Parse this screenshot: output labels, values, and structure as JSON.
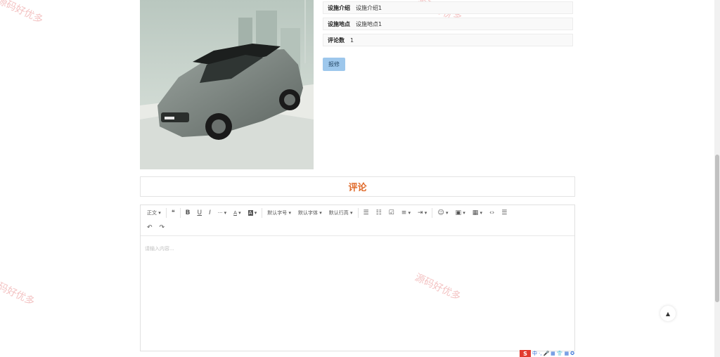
{
  "watermark_text": "源码好优多",
  "facility": {
    "rows": [
      {
        "label": "设施介绍",
        "value": "设施介绍1"
      },
      {
        "label": "设施地点",
        "value": "设施地点1"
      },
      {
        "label": "评论数",
        "value": "1"
      }
    ],
    "repair_label": "报修"
  },
  "comments": {
    "title": "评论",
    "placeholder": "请输入内容..."
  },
  "toolbar": {
    "paragraph": "正文",
    "quote": "❝",
    "bold": "B",
    "underline": "U",
    "italic": "I",
    "more": "···",
    "font_color": "A",
    "bg_color": "A",
    "font_size": "默认字号",
    "font_family": "默认字体",
    "line_height": "默认行高",
    "bullet_list": "☰",
    "numbered_list": "☷",
    "todo": "☑",
    "align": "≡",
    "indent": "⇥",
    "emoji": "☺",
    "image": "▣",
    "table": "▦",
    "code": "‹›",
    "divider": "☰",
    "undo": "↶",
    "redo": "↷"
  },
  "back_to_top": "▲",
  "ime": {
    "logo": "S",
    "lang": "中",
    "items": [
      "·,",
      "🎤",
      "▦",
      "👕",
      "▦",
      "✪"
    ]
  },
  "colors": {
    "accent": "#e06a2a",
    "button": "#9dc7ec"
  }
}
